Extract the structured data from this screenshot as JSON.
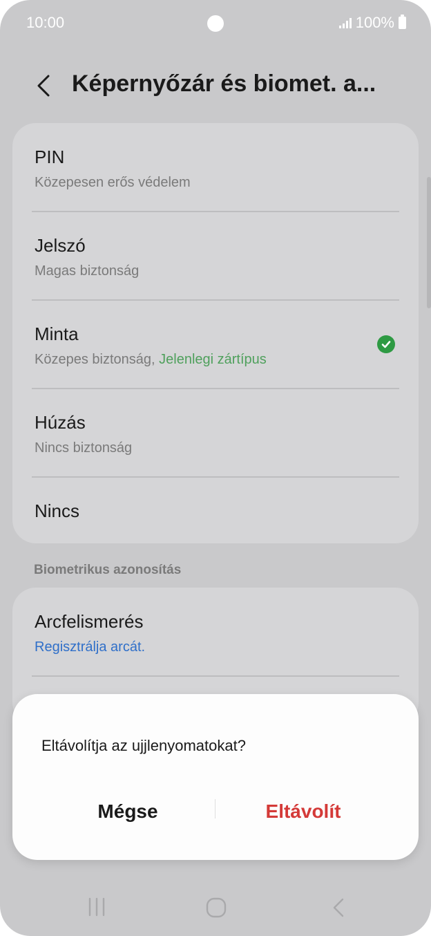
{
  "status_bar": {
    "time": "10:00",
    "battery": "100%"
  },
  "header": {
    "title": "Képernyőzár és biomet. a..."
  },
  "lock_types": [
    {
      "label": "PIN",
      "sub": "Közepesen erős védelem"
    },
    {
      "label": "Jelszó",
      "sub": "Magas biztonság"
    },
    {
      "label": "Minta",
      "sub": "Közepes biztonság, ",
      "current": "Jelenlegi zártípus"
    },
    {
      "label": "Húzás",
      "sub": "Nincs biztonság"
    },
    {
      "label": "Nincs"
    }
  ],
  "biometrics": {
    "section_title": "Biometrikus azonosítás",
    "face": {
      "label": "Arcfelismerés",
      "sub": "Regisztrálja arcát."
    }
  },
  "dialog": {
    "message": "Eltávolítja az ujjlenyomatokat?",
    "cancel_label": "Mégse",
    "remove_label": "Eltávolít"
  },
  "colors": {
    "accent_green": "#2e9a43",
    "link_blue": "#2f6fc9",
    "destructive_red": "#d43a38"
  }
}
